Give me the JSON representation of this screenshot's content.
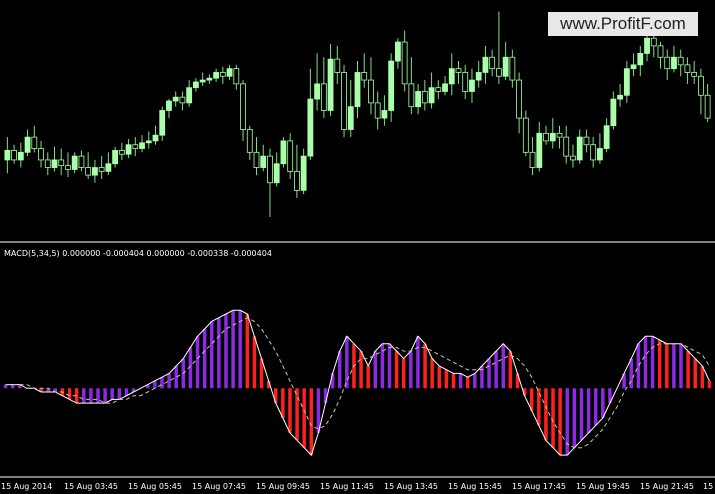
{
  "watermark": "www.ProfitF.com",
  "colors": {
    "background": "#000000",
    "bull_candle": "#aaffaa",
    "bear_candle": "#000000",
    "wick": "#7fe07f",
    "separator": "#ffffff",
    "hist_up": "#8a2be2",
    "hist_down": "#ff2020",
    "macd_line": "#ffffff",
    "signal_line": "#c8c8a0"
  },
  "indicator": {
    "label": "MACD(5,34,5) 0.000000 -0.000404 0.000000 -0.000338 -0.000404"
  },
  "time_axis": {
    "labels": [
      "15 Aug 2014",
      "15 Aug 03:45",
      "15 Aug 05:45",
      "15 Aug 07:45",
      "15 Aug 09:45",
      "15 Aug 11:45",
      "15 Aug 13:45",
      "15 Aug 15:45",
      "15 Aug 17:45",
      "15 Aug 19:45",
      "15 Aug 21:45",
      "15"
    ]
  },
  "chart_data": {
    "type": "candlestick",
    "candles": [
      [
        40,
        45,
        33,
        52
      ],
      [
        45,
        40,
        38,
        48
      ],
      [
        40,
        44,
        36,
        49
      ],
      [
        44,
        52,
        42,
        56
      ],
      [
        52,
        46,
        44,
        58
      ],
      [
        46,
        40,
        36,
        50
      ],
      [
        40,
        36,
        32,
        44
      ],
      [
        36,
        40,
        34,
        47
      ],
      [
        40,
        37,
        32,
        46
      ],
      [
        37,
        35,
        31,
        44
      ],
      [
        35,
        42,
        33,
        44
      ],
      [
        42,
        36,
        34,
        45
      ],
      [
        36,
        32,
        30,
        44
      ],
      [
        32,
        36,
        28,
        40
      ],
      [
        36,
        34,
        30,
        42
      ],
      [
        34,
        38,
        32,
        44
      ],
      [
        38,
        45,
        36,
        47
      ],
      [
        45,
        43,
        40,
        49
      ],
      [
        43,
        48,
        41,
        51
      ],
      [
        48,
        46,
        42,
        52
      ],
      [
        46,
        49,
        44,
        53
      ],
      [
        49,
        50,
        46,
        55
      ],
      [
        50,
        53,
        48,
        58
      ],
      [
        53,
        66,
        50,
        68
      ],
      [
        66,
        71,
        62,
        72
      ],
      [
        71,
        73,
        68,
        76
      ],
      [
        73,
        70,
        66,
        76
      ],
      [
        70,
        78,
        68,
        82
      ],
      [
        78,
        81,
        76,
        83
      ],
      [
        81,
        82,
        79,
        86
      ],
      [
        82,
        83,
        80,
        85
      ],
      [
        83,
        86,
        81,
        88
      ],
      [
        86,
        84,
        80,
        89
      ],
      [
        84,
        88,
        82,
        90
      ],
      [
        88,
        80,
        77,
        90
      ],
      [
        80,
        56,
        50,
        82
      ],
      [
        56,
        44,
        40,
        58
      ],
      [
        44,
        36,
        32,
        52
      ],
      [
        36,
        42,
        34,
        48
      ],
      [
        42,
        28,
        10,
        46
      ],
      [
        28,
        38,
        26,
        44
      ],
      [
        38,
        50,
        36,
        52
      ],
      [
        50,
        34,
        30,
        54
      ],
      [
        34,
        24,
        20,
        48
      ],
      [
        24,
        42,
        22,
        46
      ],
      [
        42,
        72,
        40,
        88
      ],
      [
        72,
        80,
        66,
        96
      ],
      [
        80,
        66,
        62,
        94
      ],
      [
        66,
        93,
        63,
        101
      ],
      [
        93,
        86,
        80,
        100
      ],
      [
        86,
        56,
        52,
        90
      ],
      [
        56,
        68,
        52,
        82
      ],
      [
        68,
        86,
        62,
        92
      ],
      [
        86,
        82,
        78,
        96
      ],
      [
        82,
        70,
        64,
        94
      ],
      [
        70,
        62,
        56,
        76
      ],
      [
        62,
        66,
        58,
        74
      ],
      [
        66,
        92,
        60,
        96
      ],
      [
        92,
        102,
        88,
        104
      ],
      [
        102,
        80,
        76,
        108
      ],
      [
        80,
        68,
        64,
        94
      ],
      [
        68,
        76,
        64,
        80
      ],
      [
        76,
        70,
        66,
        82
      ],
      [
        70,
        78,
        67,
        86
      ],
      [
        78,
        76,
        72,
        82
      ],
      [
        76,
        80,
        74,
        84
      ],
      [
        80,
        88,
        74,
        96
      ],
      [
        88,
        86,
        80,
        92
      ],
      [
        86,
        76,
        72,
        90
      ],
      [
        76,
        82,
        70,
        88
      ],
      [
        82,
        86,
        78,
        92
      ],
      [
        86,
        94,
        80,
        100
      ],
      [
        94,
        88,
        84,
        98
      ],
      [
        88,
        84,
        80,
        118
      ],
      [
        84,
        94,
        82,
        102
      ],
      [
        94,
        82,
        78,
        98
      ],
      [
        82,
        62,
        54,
        86
      ],
      [
        62,
        44,
        42,
        66
      ],
      [
        44,
        36,
        32,
        52
      ],
      [
        36,
        54,
        34,
        60
      ],
      [
        54,
        50,
        48,
        58
      ],
      [
        50,
        54,
        46,
        62
      ],
      [
        54,
        52,
        46,
        58
      ],
      [
        52,
        42,
        38,
        58
      ],
      [
        42,
        40,
        36,
        48
      ],
      [
        40,
        52,
        38,
        56
      ],
      [
        52,
        48,
        44,
        56
      ],
      [
        48,
        40,
        36,
        52
      ],
      [
        40,
        46,
        38,
        54
      ],
      [
        46,
        58,
        44,
        62
      ],
      [
        58,
        72,
        56,
        76
      ],
      [
        72,
        74,
        68,
        80
      ],
      [
        74,
        88,
        70,
        92
      ],
      [
        88,
        90,
        84,
        96
      ],
      [
        90,
        96,
        84,
        100
      ],
      [
        96,
        104,
        92,
        106
      ],
      [
        104,
        100,
        94,
        110
      ],
      [
        100,
        94,
        88,
        102
      ],
      [
        94,
        88,
        82,
        98
      ],
      [
        88,
        94,
        86,
        100
      ],
      [
        94,
        90,
        84,
        98
      ],
      [
        90,
        86,
        80,
        94
      ],
      [
        86,
        84,
        80,
        92
      ],
      [
        84,
        74,
        64,
        88
      ],
      [
        74,
        62,
        60,
        80
      ]
    ],
    "macd_histogram": [
      1,
      1,
      1,
      0,
      0,
      -1,
      -1,
      -1,
      -2,
      -3,
      -4,
      -4,
      -4,
      -4,
      -4,
      -3,
      -3,
      -2,
      -1,
      0,
      1,
      2,
      3,
      4,
      6,
      8,
      11,
      14,
      16,
      18,
      19,
      20,
      21,
      21,
      20,
      14,
      8,
      2,
      -4,
      -8,
      -12,
      -14,
      -16,
      -18,
      -12,
      -4,
      4,
      10,
      14,
      12,
      10,
      6,
      10,
      12,
      12,
      10,
      8,
      10,
      14,
      12,
      8,
      6,
      5,
      4,
      4,
      3,
      4,
      6,
      8,
      10,
      12,
      10,
      4,
      -2,
      -6,
      -10,
      -14,
      -16,
      -18,
      -18,
      -16,
      -14,
      -12,
      -10,
      -8,
      -4,
      0,
      4,
      8,
      12,
      14,
      14,
      13,
      12,
      12,
      12,
      10,
      8,
      6,
      2
    ],
    "signal": [
      1,
      1,
      1,
      1,
      0,
      0,
      0,
      -1,
      -1,
      -2,
      -2,
      -3,
      -3,
      -3,
      -4,
      -4,
      -3,
      -3,
      -2,
      -2,
      -1,
      0,
      1,
      2,
      3,
      4,
      6,
      8,
      10,
      12,
      14,
      16,
      17,
      18,
      19,
      18,
      16,
      13,
      10,
      6,
      2,
      -2,
      -6,
      -10,
      -11,
      -10,
      -7,
      -3,
      2,
      6,
      8,
      8,
      9,
      10,
      11,
      11,
      10,
      10,
      11,
      11,
      10,
      9,
      8,
      7,
      6,
      5,
      5,
      5,
      6,
      7,
      8,
      9,
      8,
      6,
      3,
      -1,
      -5,
      -9,
      -12,
      -15,
      -16,
      -16,
      -15,
      -13,
      -11,
      -8,
      -5,
      -1,
      2,
      6,
      9,
      11,
      12,
      12,
      12,
      12,
      11,
      10,
      9,
      6
    ],
    "hist_range": [
      -22,
      34
    ],
    "price_range": [
      0,
      122
    ]
  }
}
